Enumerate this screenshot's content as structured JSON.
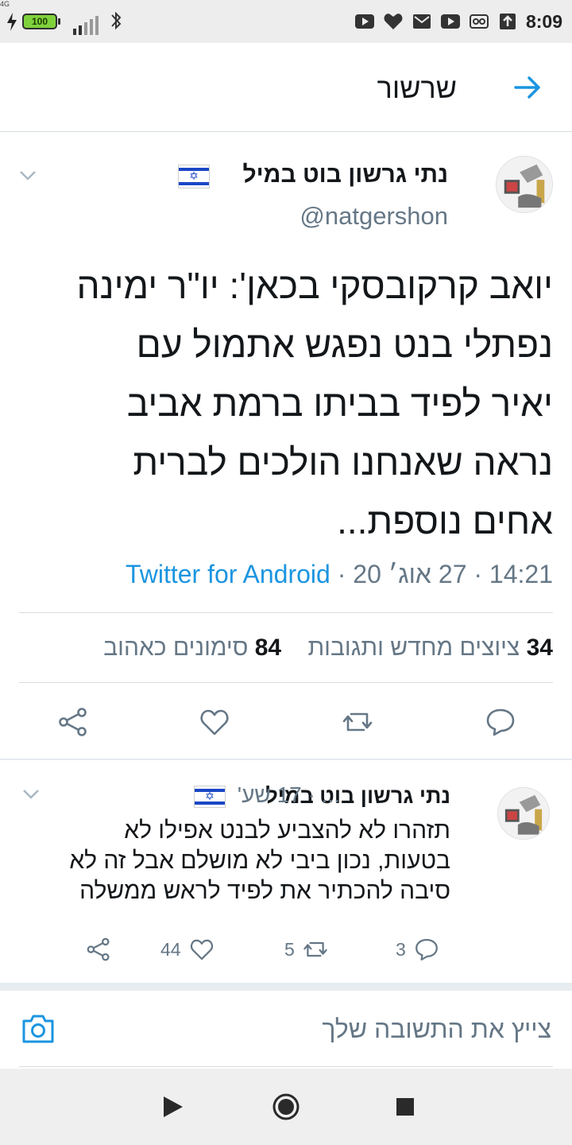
{
  "status_bar": {
    "battery": "100",
    "network": "4G",
    "time": "8:09"
  },
  "header": {
    "title": "שרשור",
    "back_icon": "arrow-right-icon"
  },
  "main_tweet": {
    "author": "נתי גרשון בוט במיל",
    "handle": "@natgershon",
    "text_lines": [
      "יואב קרקובסקי בכאן': יו\"ר ימינה",
      "נפתלי בנט נפגש אתמול עם",
      "יאיר לפיד בביתו ברמת אביב",
      "נראה שאנחנו הולכים לברית",
      "אחים נוספת..."
    ],
    "time": "14:21",
    "date": "27 אוג׳ 20",
    "source": "Twitter for Android",
    "retweets_count": "34",
    "retweets_label": "ציוצים מחדש ותגובות",
    "likes_count": "84",
    "likes_label": "סימונים כאהוב"
  },
  "reply_tweet": {
    "author": "נתי גרשון בוט במיל",
    "meta": "... · 17 שע'",
    "text_lines": [
      "תזהרו  לא להצביע לבנט אפילו לא",
      "בטעות, נכון ביבי לא מושלם אבל זה לא",
      "סיבה להכתיר את לפיד לראש ממשלה"
    ],
    "replies": "3",
    "retweets": "5",
    "likes": "44"
  },
  "compose": {
    "placeholder": "צייץ את התשובה שלך"
  },
  "colors": {
    "accent": "#1b95e0",
    "secondary_text": "#657786",
    "divider": "#d8dde2"
  }
}
